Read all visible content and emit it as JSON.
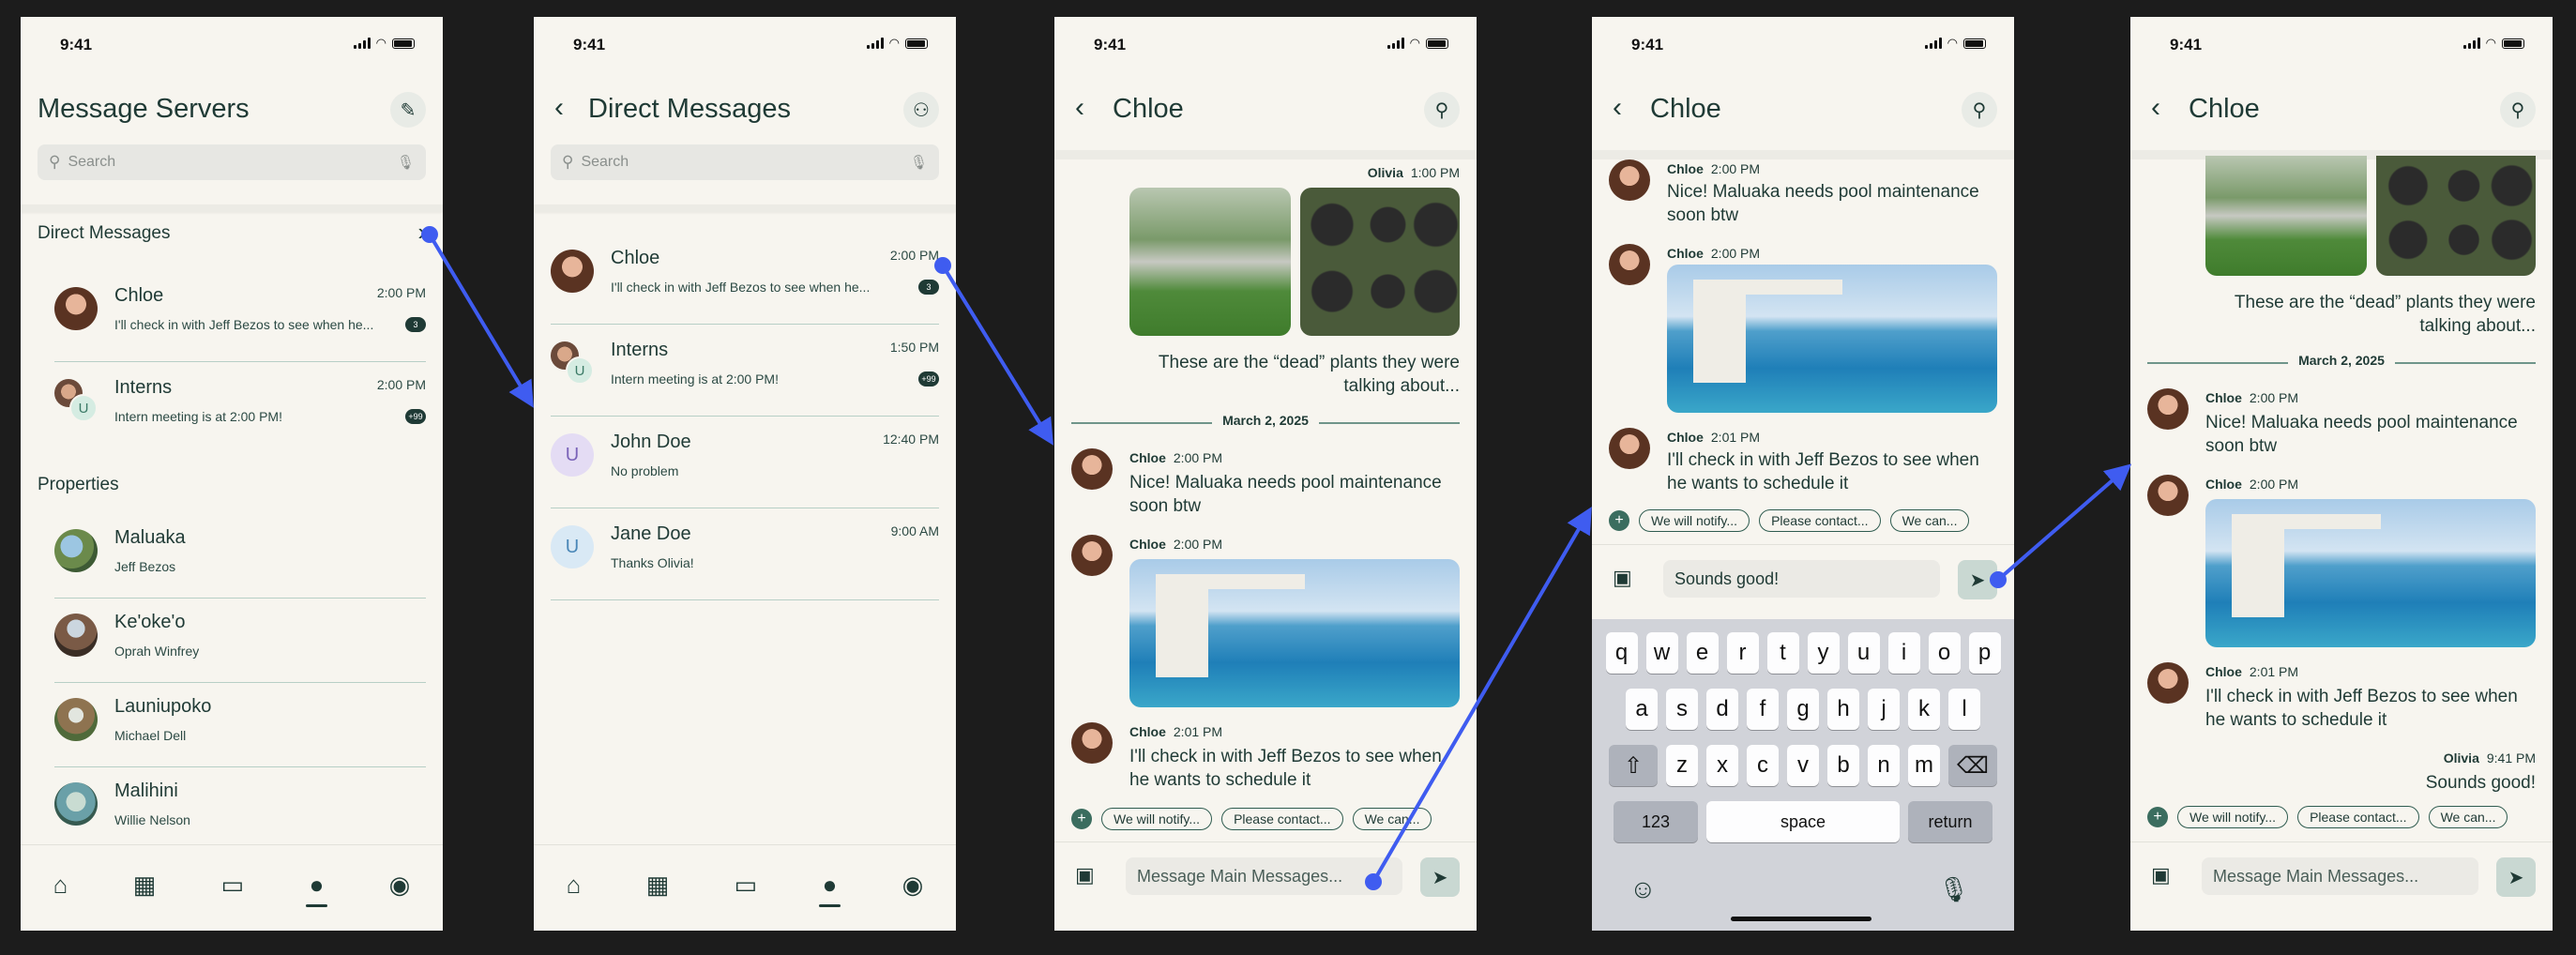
{
  "status": {
    "time": "9:41"
  },
  "screen1": {
    "title": "Message Servers",
    "search_placeholder": "Search",
    "direct_messages_label": "Direct Messages",
    "dms": [
      {
        "name": "Chloe",
        "time": "2:00 PM",
        "preview": "I'll check in with Jeff Bezos to see when he...",
        "badge": "3"
      },
      {
        "name": "Interns",
        "time": "2:00 PM",
        "preview": "Intern meeting is at 2:00 PM!",
        "badge": "+99"
      }
    ],
    "properties_label": "Properties",
    "properties": [
      {
        "name": "Maluaka",
        "owner": "Jeff Bezos"
      },
      {
        "name": "Ke'oke'o",
        "owner": "Oprah Winfrey"
      },
      {
        "name": "Launiupoko",
        "owner": "Michael Dell"
      },
      {
        "name": "Malihini",
        "owner": "Willie Nelson"
      }
    ]
  },
  "screen2": {
    "title": "Direct Messages",
    "search_placeholder": "Search",
    "dms": [
      {
        "name": "Chloe",
        "time": "2:00 PM",
        "preview": "I'll check in with Jeff Bezos to see when he...",
        "badge": "3"
      },
      {
        "name": "Interns",
        "time": "1:50 PM",
        "preview": "Intern meeting is at 2:00 PM!",
        "badge": "+99"
      },
      {
        "name": "John Doe",
        "time": "12:40 PM",
        "preview": "No problem",
        "initial": "U"
      },
      {
        "name": "Jane Doe",
        "time": "9:00 AM",
        "preview": "Thanks Olivia!",
        "initial": "U"
      }
    ]
  },
  "chat": {
    "title": "Chloe",
    "olivia_sender": "Olivia",
    "olivia_time": "1:00 PM",
    "olivia_text": "These are the “dead” plants they were talking about...",
    "date": "March 2, 2025",
    "sender": "Chloe",
    "msg1_time": "2:00 PM",
    "msg1_text": "Nice! Maluaka needs pool maintenance soon btw",
    "msg2_time": "2:00 PM",
    "msg3_time": "2:01 PM",
    "msg3_text": "I'll check in with Jeff Bezos to see when he wants to schedule it",
    "chips": [
      "We will notify...",
      "Please contact...",
      "We can..."
    ],
    "composer_placeholder": "Message Main Messages...",
    "typed_text": "Sounds good!",
    "reply_sender": "Olivia",
    "reply_time": "9:41 PM",
    "reply_text": "Sounds good!"
  },
  "keyboard": {
    "row1": [
      "q",
      "w",
      "e",
      "r",
      "t",
      "y",
      "u",
      "i",
      "o",
      "p"
    ],
    "row2": [
      "a",
      "s",
      "d",
      "f",
      "g",
      "h",
      "j",
      "k",
      "l"
    ],
    "row3": [
      "z",
      "x",
      "c",
      "v",
      "b",
      "n",
      "m"
    ],
    "num_key": "123",
    "space_key": "space",
    "return_key": "return"
  },
  "icons": {
    "edit": "pencil-icon",
    "add_user": "add-user-icon",
    "search": "search-icon",
    "back": "chevron-left-icon",
    "nav": [
      "home-icon",
      "calendar-icon",
      "folder-icon",
      "chat-icon",
      "profile-icon"
    ]
  },
  "colors": {
    "accent": "#1f3a35",
    "arrow": "#3f5cf0",
    "background": "#f7f5ef"
  }
}
